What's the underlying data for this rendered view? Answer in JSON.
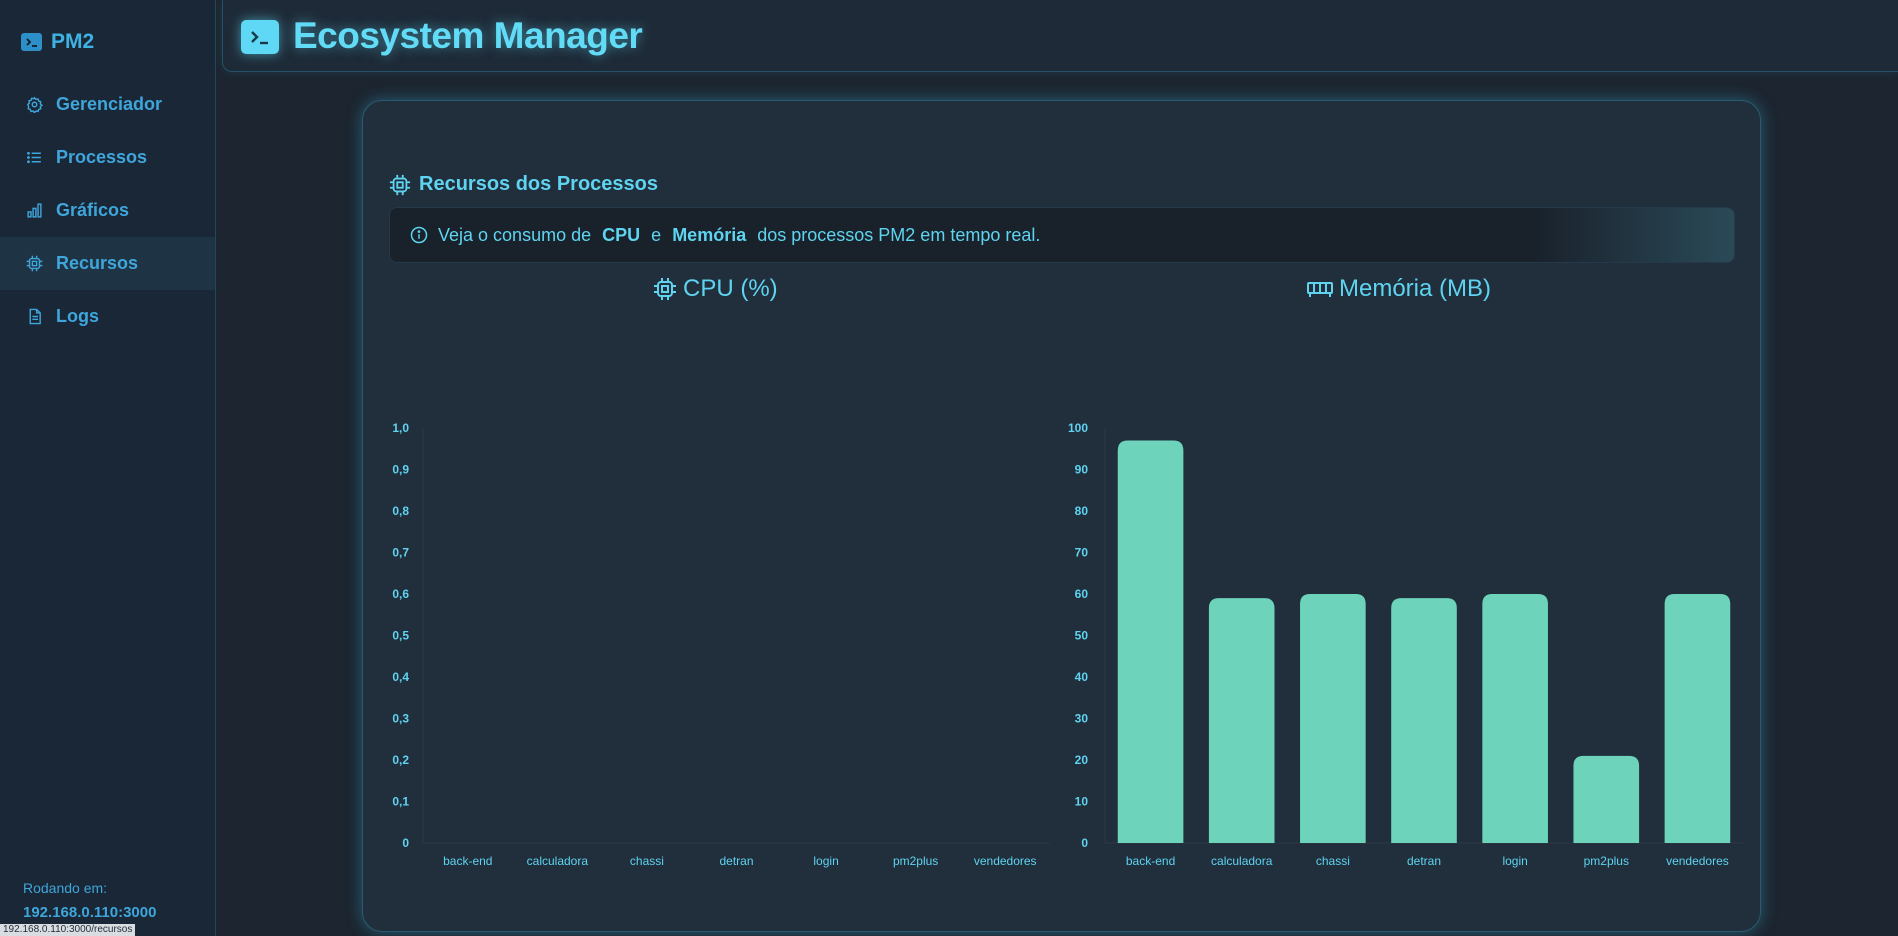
{
  "sidebar": {
    "brand": "PM2",
    "items": [
      {
        "label": "Gerenciador",
        "icon": "gear-icon"
      },
      {
        "label": "Processos",
        "icon": "list-icon"
      },
      {
        "label": "Gráficos",
        "icon": "bar-chart-icon"
      },
      {
        "label": "Recursos",
        "icon": "cpu-icon"
      },
      {
        "label": "Logs",
        "icon": "document-icon"
      }
    ],
    "active": "Recursos",
    "footer_label": "Rodando em:",
    "footer_host": "192.168.0.110:3000"
  },
  "status_url": "192.168.0.110:3000/recursos",
  "header": {
    "title": "Ecosystem Manager"
  },
  "main": {
    "section_title": "Recursos dos Processos",
    "info": {
      "prefix": "Veja o consumo de",
      "cpu": "CPU",
      "conj": "e",
      "mem": "Memória",
      "suffix": "dos processos PM2 em tempo real."
    }
  },
  "colors": {
    "accent": "#5ed4f0",
    "bar": "#6dd3bb",
    "sidebar_text": "#3fa6dc"
  },
  "chart_data": [
    {
      "type": "bar",
      "title": "CPU (%)",
      "categories": [
        "back-end",
        "calculadora",
        "chassi",
        "detran",
        "login",
        "pm2plus",
        "vendedores"
      ],
      "values": [
        0,
        0,
        0,
        0,
        0,
        0,
        0
      ],
      "yticks": [
        "0",
        "0,1",
        "0,2",
        "0,3",
        "0,4",
        "0,5",
        "0,6",
        "0,7",
        "0,8",
        "0,9",
        "1,0"
      ],
      "ylim": [
        0,
        1
      ]
    },
    {
      "type": "bar",
      "title": "Memória (MB)",
      "categories": [
        "back-end",
        "calculadora",
        "chassi",
        "detran",
        "login",
        "pm2plus",
        "vendedores"
      ],
      "values": [
        97,
        59,
        60,
        59,
        60,
        21,
        60
      ],
      "yticks": [
        "0",
        "10",
        "20",
        "30",
        "40",
        "50",
        "60",
        "70",
        "80",
        "90",
        "100"
      ],
      "ylim": [
        0,
        100
      ]
    }
  ]
}
